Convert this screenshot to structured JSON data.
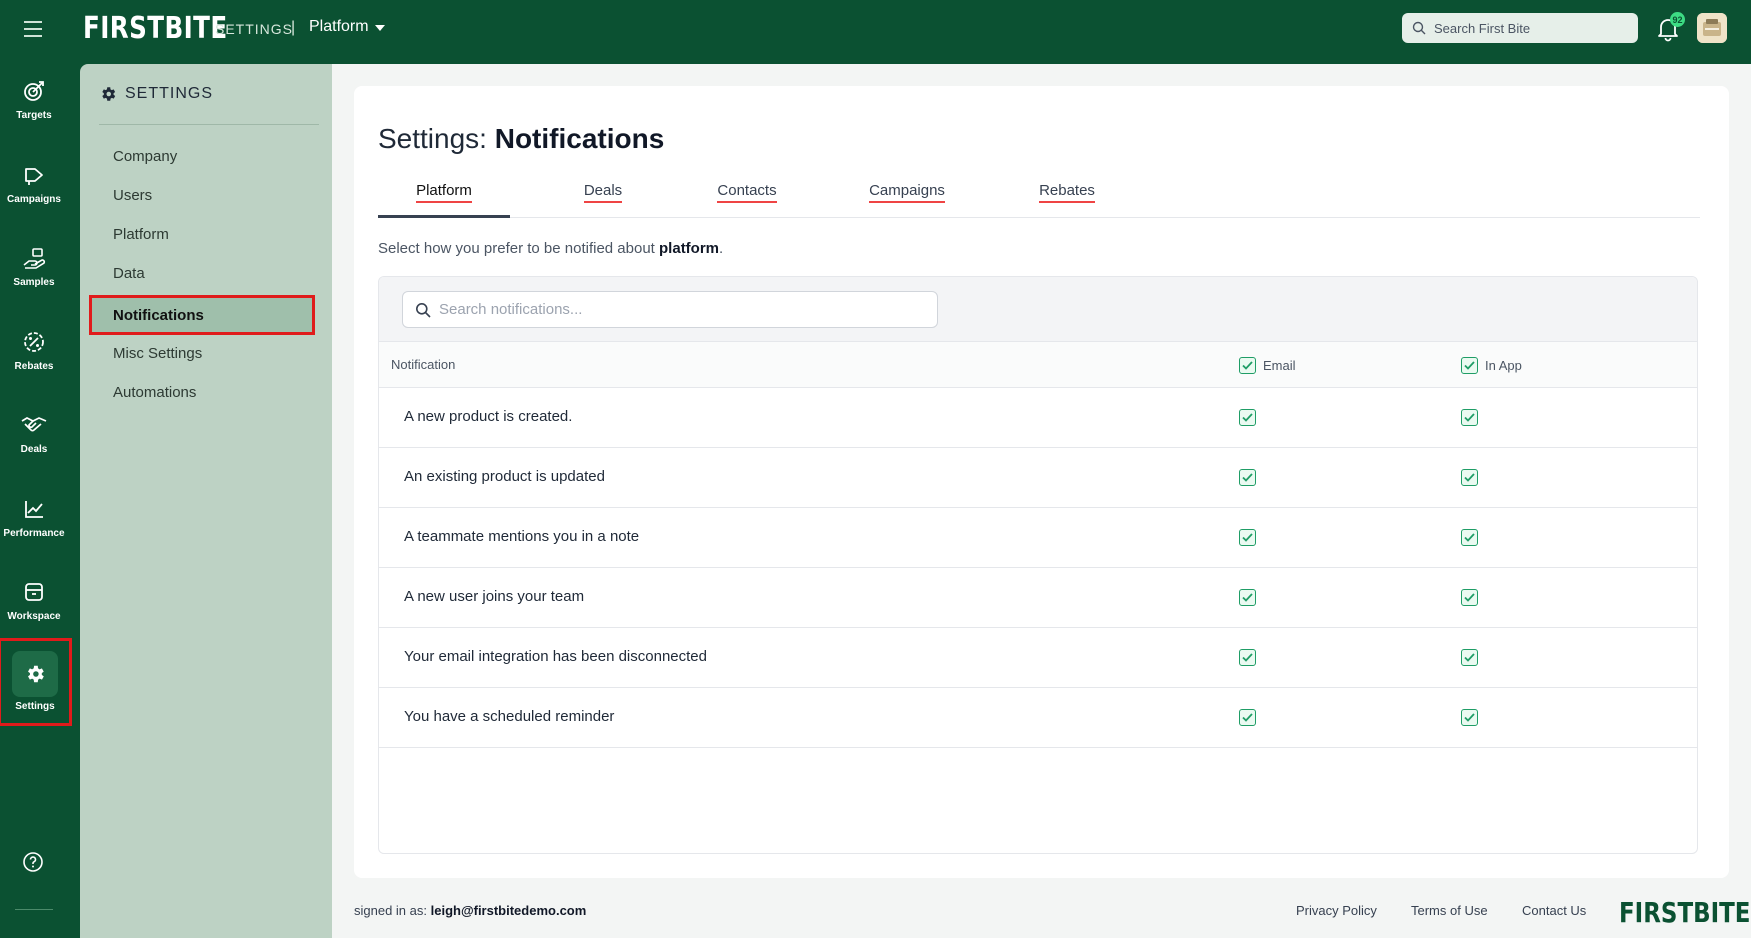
{
  "app": {
    "logo": "FIRSTBITE",
    "section_label": "SETTINGS",
    "section_separator": "|",
    "platform_select": "Platform",
    "search_placeholder": "Search First Bite",
    "notification_count": "92"
  },
  "rail": {
    "items": [
      {
        "label": "Targets",
        "icon": "target-icon"
      },
      {
        "label": "Campaigns",
        "icon": "megaphone-icon"
      },
      {
        "label": "Samples",
        "icon": "hand-gift-icon"
      },
      {
        "label": "Rebates",
        "icon": "percent-badge-icon"
      },
      {
        "label": "Deals",
        "icon": "handshake-icon"
      },
      {
        "label": "Performance",
        "icon": "chart-line-icon"
      },
      {
        "label": "Workspace",
        "icon": "archive-box-icon"
      },
      {
        "label": "Settings",
        "icon": "gear-icon"
      }
    ]
  },
  "settings_nav": {
    "title": "SETTINGS",
    "items": [
      "Company",
      "Users",
      "Platform",
      "Data",
      "Notifications",
      "Misc Settings",
      "Automations"
    ],
    "active": "Notifications"
  },
  "page": {
    "title_prefix": "Settings: ",
    "title_main": "Notifications",
    "tabs": [
      "Platform",
      "Deals",
      "Contacts",
      "Campaigns",
      "Rebates"
    ],
    "active_tab": "Platform",
    "intro_prefix": "Select how you prefer to be notified about ",
    "intro_bold": "platform",
    "intro_suffix": ".",
    "search_placeholder": "Search notifications..."
  },
  "table": {
    "headers": {
      "notification": "Notification",
      "email": "Email",
      "in_app": "In App"
    },
    "rows": [
      {
        "text": "A new product is created.",
        "email": true,
        "in_app": true
      },
      {
        "text": "An existing product is updated",
        "email": true,
        "in_app": true
      },
      {
        "text": "A teammate mentions you in a note",
        "email": true,
        "in_app": true
      },
      {
        "text": "A new user joins your team",
        "email": true,
        "in_app": true
      },
      {
        "text": "Your email integration has been disconnected",
        "email": true,
        "in_app": true
      },
      {
        "text": "You have a scheduled reminder",
        "email": true,
        "in_app": true
      }
    ]
  },
  "footer": {
    "signed_in_label": "signed in as: ",
    "user_email": "leigh@firstbitedemo.com",
    "links": [
      "Privacy Policy",
      "Terms of Use",
      "Contact Us"
    ],
    "logo": "FIRSTBITE"
  },
  "colors": {
    "brand_green": "#0b5132",
    "panel_green": "#bdd2c4",
    "check_green": "#1f9d66",
    "highlight_red": "#e01b1b"
  }
}
